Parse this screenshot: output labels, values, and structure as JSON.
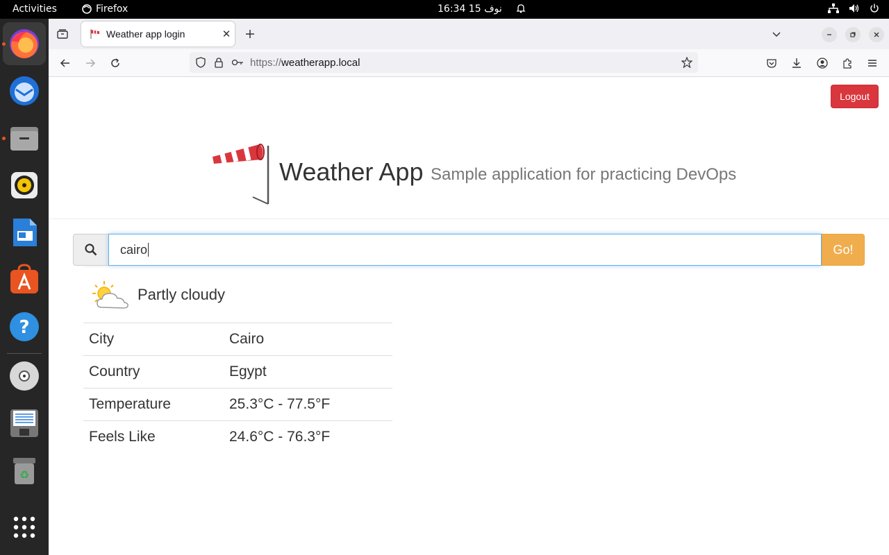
{
  "topbar": {
    "activities": "Activities",
    "app_name": "Firefox",
    "clock": "16:34  نوف 15"
  },
  "dock": {
    "items": [
      "Firefox",
      "Thunderbird",
      "Files",
      "Rhythmbox",
      "LibreOffice Writer",
      "Ubuntu Software",
      "Help",
      "DVD",
      "Text Editor",
      "Trash",
      "Show Applications"
    ]
  },
  "browser": {
    "tab_title": "Weather app login",
    "url_proto": "https://",
    "url_host": "weatherapp.local"
  },
  "page": {
    "logout_label": "Logout",
    "app_title": "Weather App",
    "app_subtitle": "Sample application for practicing DevOps",
    "search_value": "cairo",
    "go_label": "Go!",
    "condition": "Partly cloudy",
    "rows": [
      {
        "key": "City",
        "value": "Cairo"
      },
      {
        "key": "Country",
        "value": "Egypt"
      },
      {
        "key": "Temperature",
        "value": "25.3°C - 77.5°F"
      },
      {
        "key": "Feels Like",
        "value": "24.6°C - 76.3°F"
      }
    ]
  },
  "colors": {
    "logout": "#d9363e",
    "go": "#f0ad4e",
    "focus": "#66afe9",
    "accent": "#e95420"
  }
}
